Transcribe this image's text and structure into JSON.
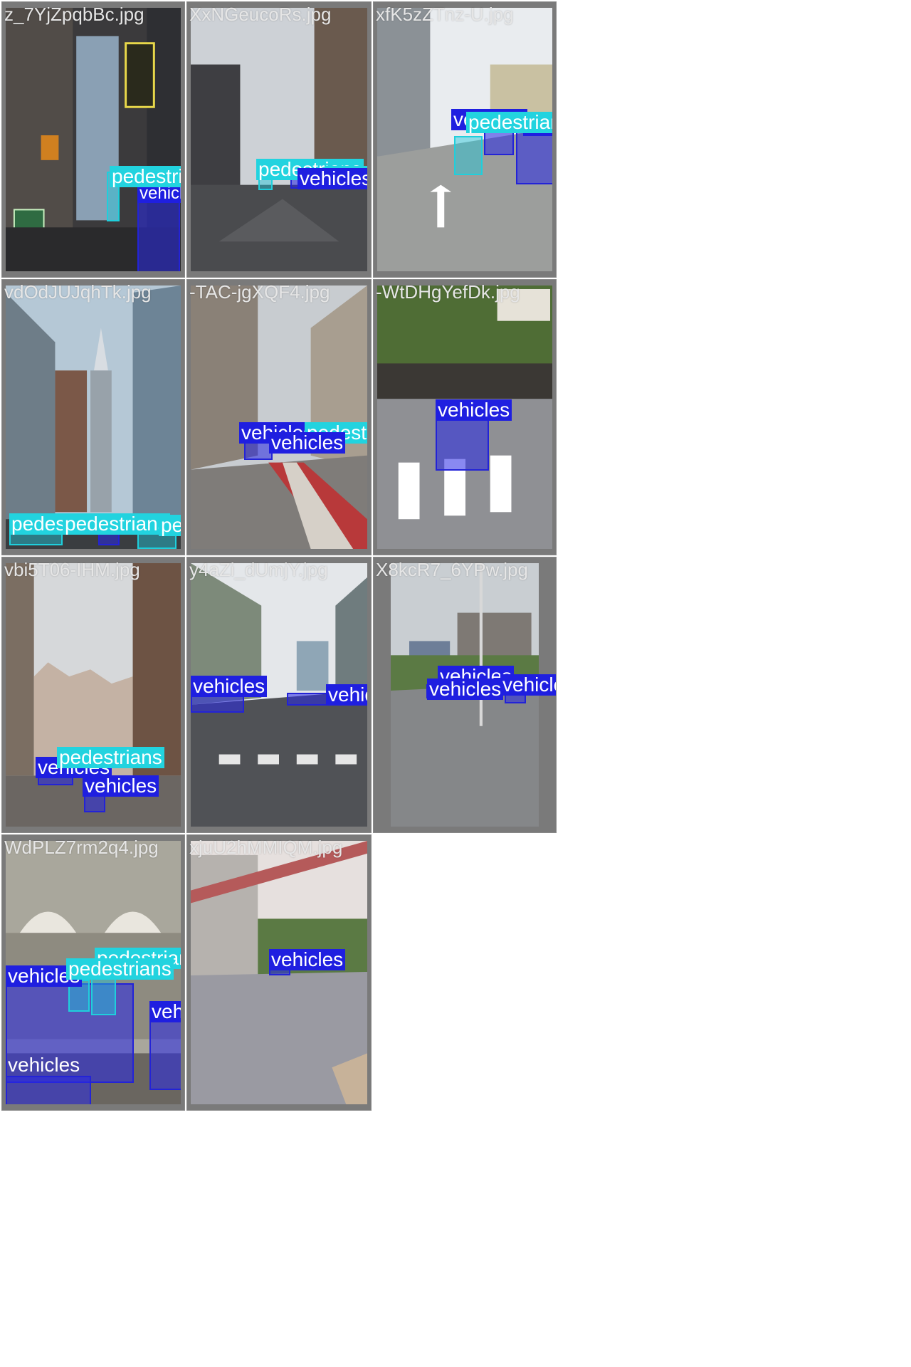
{
  "colors": {
    "vehicles": "#1f1fe0",
    "pedestrians": "#22d3df",
    "tile": "#7a7a7a"
  },
  "classes": {
    "vehicles": "vehicles",
    "pedestrians": "pedestrians"
  },
  "tiles": [
    {
      "filename": "z_7YjZpqbBc.jpg"
    },
    {
      "filename": "XxNGeucoRs.jpg"
    },
    {
      "filename": "xfK5zZTnz-U.jpg"
    },
    {
      "filename": "vdOdJUJqhTk.jpg"
    },
    {
      "filename": "-TAC-jgXQF4.jpg"
    },
    {
      "filename": "-WtDHgYefDk.jpg"
    },
    {
      "filename": "vbi5T06-IHM.jpg"
    },
    {
      "filename": "y4aZi_dUmjY.jpg"
    },
    {
      "filename": "X8kcR7_6YPw.jpg"
    },
    {
      "filename": "WdPLZ7rm2q4.jpg"
    },
    {
      "filename": "xjuU2hMMIQM.jpg"
    }
  ]
}
